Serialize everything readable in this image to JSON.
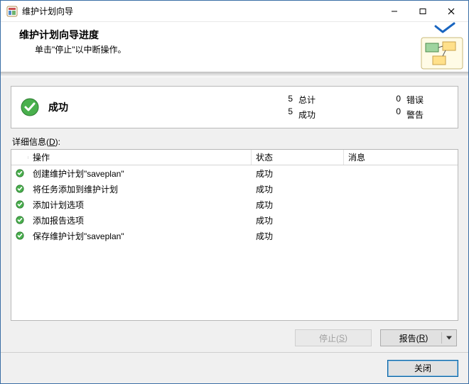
{
  "window": {
    "title": "维护计划向导"
  },
  "header": {
    "title": "维护计划向导进度",
    "subtitle": "单击\"停止\"以中断操作。"
  },
  "summary": {
    "status": "成功",
    "total_n": "5",
    "total_l": "总计",
    "succ_n": "5",
    "succ_l": "成功",
    "err_n": "0",
    "err_l": "错误",
    "warn_n": "0",
    "warn_l": "警告"
  },
  "detail": {
    "label_pre": "详细信息(",
    "label_accel": "D",
    "label_post": "):",
    "columns": {
      "op": "操作",
      "status": "状态",
      "msg": "消息"
    },
    "rows": [
      {
        "op": "创建维护计划\"saveplan\"",
        "status": "成功",
        "msg": ""
      },
      {
        "op": "将任务添加到维护计划",
        "status": "成功",
        "msg": ""
      },
      {
        "op": "添加计划选项",
        "status": "成功",
        "msg": ""
      },
      {
        "op": "添加报告选项",
        "status": "成功",
        "msg": ""
      },
      {
        "op": "保存维护计划\"saveplan\"",
        "status": "成功",
        "msg": ""
      }
    ]
  },
  "buttons": {
    "stop_pre": "停止(",
    "stop_accel": "S",
    "stop_post": ")",
    "report_pre": "报告(",
    "report_accel": "R",
    "report_post": ")",
    "close": "关闭"
  }
}
